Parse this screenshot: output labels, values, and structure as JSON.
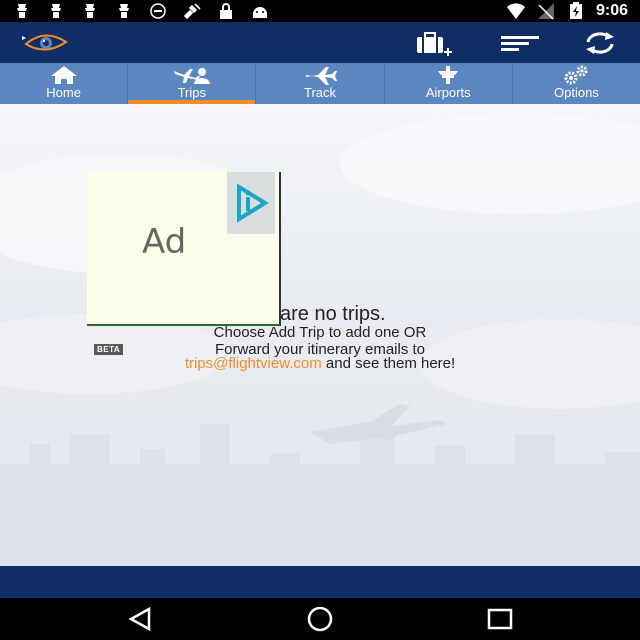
{
  "status_bar": {
    "time": "9:06",
    "icons": [
      "notification-icon",
      "notification-icon",
      "notification-icon",
      "notification-icon",
      "info-icon",
      "satellite-icon",
      "lock-icon",
      "android-icon",
      "wifi-icon",
      "signal-icon",
      "battery-charging-icon"
    ]
  },
  "app_bar": {
    "logo": "flightview-eye-logo",
    "actions": [
      "add-trip-icon",
      "menu-icon",
      "refresh-icon"
    ]
  },
  "tabs": [
    {
      "label": "Home",
      "icon": "home-icon",
      "active": false
    },
    {
      "label": "Trips",
      "icon": "trips-icon",
      "active": true
    },
    {
      "label": "Track",
      "icon": "airplane-icon",
      "active": false
    },
    {
      "label": "Airports",
      "icon": "airport-icon",
      "active": false
    },
    {
      "label": "Options",
      "icon": "gears-icon",
      "active": false
    }
  ],
  "ad": {
    "text": "Ad"
  },
  "empty_state": {
    "title": "are no trips.",
    "line1": "Choose Add Trip to add one OR",
    "beta": "BETA",
    "line2": "Forward your itinerary emails to",
    "email": "trips@flightview.com",
    "line3_suffix": " and see them here!"
  },
  "colors": {
    "app_bar": "#0f2e66",
    "tab_bar": "#5b86c0",
    "accent": "#f28c28"
  }
}
